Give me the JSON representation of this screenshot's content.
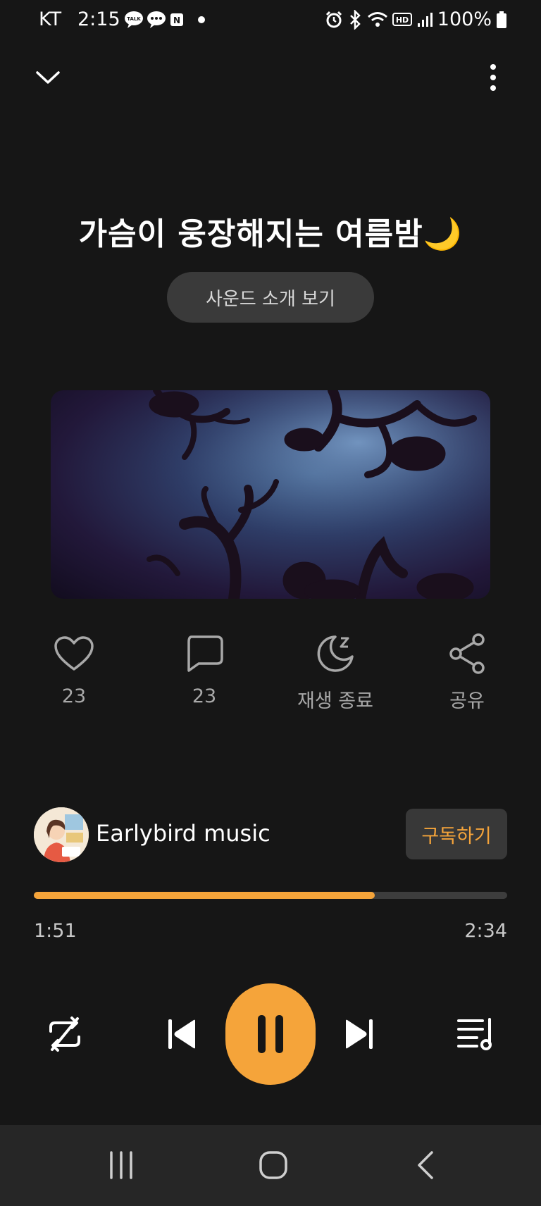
{
  "status_bar": {
    "carrier": "KT",
    "time": "2:15",
    "battery": "100%",
    "left_icons": [
      "talk-icon",
      "message-icon",
      "naver-icon",
      "dot-icon"
    ],
    "right_icons": [
      "alarm-icon",
      "bluetooth-icon",
      "wifi-icon",
      "hd-icon",
      "signal-icon",
      "battery-icon"
    ]
  },
  "header": {
    "collapse_icon": "chevron-down-icon",
    "more_icon": "more-vertical-icon"
  },
  "track": {
    "title": "가슴이 웅장해지는 여름밤🌙",
    "intro_label": "사운드 소개 보기"
  },
  "actions": {
    "like": {
      "icon": "heart-icon",
      "label": "23"
    },
    "comment": {
      "icon": "comment-icon",
      "label": "23"
    },
    "sleep": {
      "icon": "sleep-timer-icon",
      "label": "재생 종료"
    },
    "share": {
      "icon": "share-icon",
      "label": "공유"
    }
  },
  "channel": {
    "name": "Earlybird music",
    "subscribe_label": "구독하기"
  },
  "player": {
    "current_time": "1:51",
    "total_time": "2:34",
    "progress": 0.72,
    "controls": [
      "repeat-icon",
      "previous-icon",
      "pause-icon",
      "next-icon",
      "playlist-icon"
    ]
  },
  "colors": {
    "accent": "#f5a43a",
    "background": "#161616",
    "button_bg": "#3a3a3a",
    "nav_bg": "#262626"
  }
}
